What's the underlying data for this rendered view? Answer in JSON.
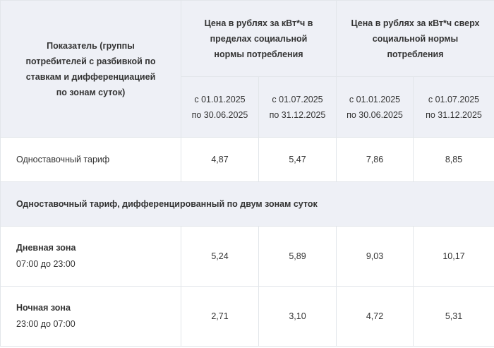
{
  "header": {
    "indicator": "Показатель (группы потребителей с разбивкой по ставкам и дифференциацией по зонам суток)",
    "within_norm": "Цена в рублях за кВт*ч в пределах социальной нормы потребления",
    "above_norm": "Цена в рублях за кВт*ч сверх социальной нормы потребления",
    "periods": [
      {
        "from": "с 01.01.2025",
        "to": "по 30.06.2025"
      },
      {
        "from": "с 01.07.2025",
        "to": "по 31.12.2025"
      },
      {
        "from": "с 01.01.2025",
        "to": "по 30.06.2025"
      },
      {
        "from": "с 01.07.2025",
        "to": "по 31.12.2025"
      }
    ]
  },
  "rows": {
    "single": {
      "label": "Одноставочный тариф",
      "values": [
        "4,87",
        "5,47",
        "7,86",
        "8,85"
      ]
    },
    "section_title": "Одноставочный тариф, дифференцированный по двум зонам суток",
    "day": {
      "name": "Дневная зона",
      "time": "07:00 до 23:00",
      "values": [
        "5,24",
        "5,89",
        "9,03",
        "10,17"
      ]
    },
    "night": {
      "name": "Ночная зона",
      "time": "23:00 до 07:00",
      "values": [
        "2,71",
        "3,10",
        "4,72",
        "5,31"
      ]
    }
  }
}
